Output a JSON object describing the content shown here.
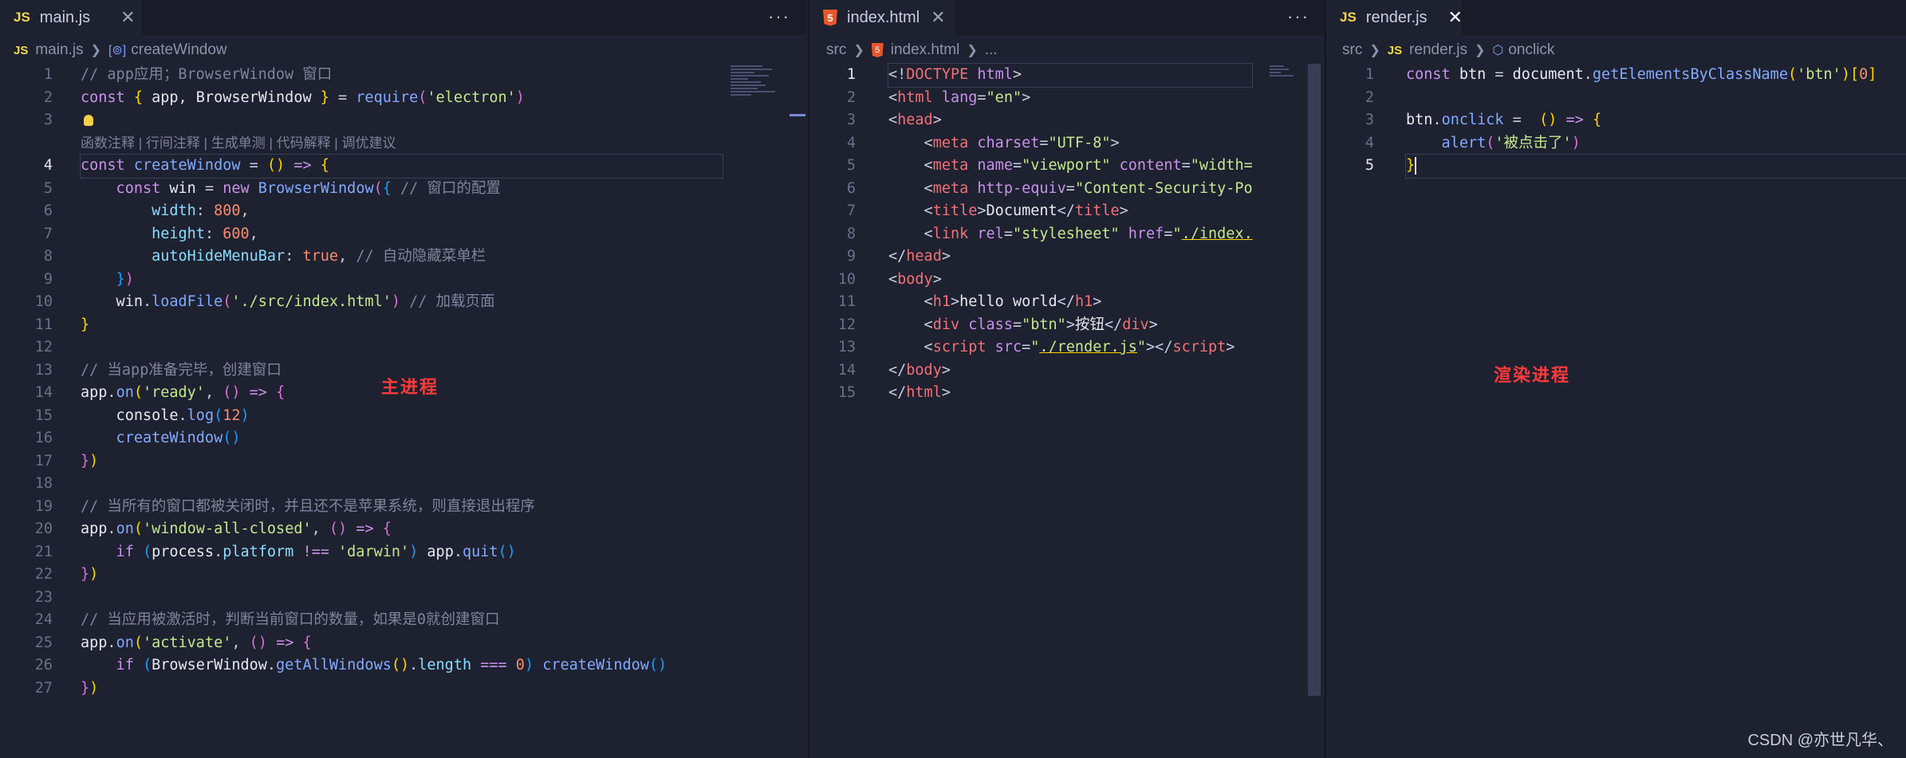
{
  "panes": [
    {
      "tab": {
        "icon": "JS",
        "label": "main.js",
        "close": "✕"
      },
      "breadcrumb": {
        "file_icon": "JS",
        "file": "main.js",
        "symbol": "createWindow"
      },
      "more": "···",
      "codelens": "函数注释 | 行间注释 | 生成单测 | 代码解释 | 调优建议"
    },
    {
      "tab": {
        "icon": "5",
        "label": "index.html",
        "close": "✕"
      },
      "breadcrumb": {
        "folder": "src",
        "file_icon": "5",
        "file": "index.html",
        "symbol": "..."
      },
      "more": "···"
    },
    {
      "tab": {
        "icon": "JS",
        "label": "render.js",
        "close": "✕"
      },
      "breadcrumb": {
        "folder": "src",
        "file_icon": "JS",
        "file": "render.js",
        "symbol": "onclick"
      }
    }
  ],
  "annotations": {
    "main_process": "主进程",
    "render_process": "渲染进程"
  },
  "watermark": "CSDN @亦世凡华、",
  "code": {
    "main": [
      [
        [
          "// app应用；BrowserWindow 窗口",
          "cm"
        ]
      ],
      [
        [
          "const ",
          "kw"
        ],
        [
          "{",
          "br1"
        ],
        [
          " app, ",
          "var"
        ],
        [
          "BrowserWindow",
          "var"
        ],
        [
          " ",
          "pl"
        ],
        [
          "}",
          "br1"
        ],
        [
          " = ",
          "pl"
        ],
        [
          "require",
          "fn"
        ],
        [
          "(",
          "br2"
        ],
        [
          "'electron'",
          "str"
        ],
        [
          ")",
          "br2"
        ]
      ],
      [],
      [
        [
          "const ",
          "kw"
        ],
        [
          "createWindow",
          "fn"
        ],
        [
          " = ",
          "pl"
        ],
        [
          "()",
          "br1"
        ],
        [
          " => ",
          "kw"
        ],
        [
          "{",
          "br1"
        ]
      ],
      [
        [
          "    const ",
          "kw"
        ],
        [
          "win",
          "var"
        ],
        [
          " = ",
          "pl"
        ],
        [
          "new ",
          "kw"
        ],
        [
          "BrowserWindow",
          "fn"
        ],
        [
          "(",
          "br2"
        ],
        [
          "{",
          "br3"
        ],
        [
          " // 窗口的配置",
          "cm"
        ]
      ],
      [
        [
          "        width",
          "prop"
        ],
        [
          ": ",
          "pl"
        ],
        [
          "800",
          "num"
        ],
        [
          ",",
          "pl"
        ]
      ],
      [
        [
          "        height",
          "prop"
        ],
        [
          ": ",
          "pl"
        ],
        [
          "600",
          "num"
        ],
        [
          ",",
          "pl"
        ]
      ],
      [
        [
          "        autoHideMenuBar",
          "prop"
        ],
        [
          ": ",
          "pl"
        ],
        [
          "true",
          "num"
        ],
        [
          ", ",
          "pl"
        ],
        [
          "// 自动隐藏菜单栏",
          "cm"
        ]
      ],
      [
        [
          "    }",
          "br3"
        ],
        [
          ")",
          "br2"
        ]
      ],
      [
        [
          "    win",
          "var"
        ],
        [
          ".",
          "pl"
        ],
        [
          "loadFile",
          "fn"
        ],
        [
          "(",
          "br2"
        ],
        [
          "'./src/index.html'",
          "str"
        ],
        [
          ")",
          "br2"
        ],
        [
          " // 加载页面",
          "cm"
        ]
      ],
      [
        [
          "}",
          "br1"
        ]
      ],
      [],
      [
        [
          "// 当app准备完毕，创建窗口",
          "cm"
        ]
      ],
      [
        [
          "app",
          "var"
        ],
        [
          ".",
          "pl"
        ],
        [
          "on",
          "fn"
        ],
        [
          "(",
          "br1"
        ],
        [
          "'ready'",
          "str"
        ],
        [
          ", ",
          "pl"
        ],
        [
          "()",
          "br2"
        ],
        [
          " => ",
          "kw"
        ],
        [
          "{",
          "br2"
        ]
      ],
      [
        [
          "    console",
          "var"
        ],
        [
          ".",
          "pl"
        ],
        [
          "log",
          "fn"
        ],
        [
          "(",
          "br3"
        ],
        [
          "12",
          "num"
        ],
        [
          ")",
          "br3"
        ]
      ],
      [
        [
          "    createWindow",
          "fn"
        ],
        [
          "()",
          "br3"
        ]
      ],
      [
        [
          "}",
          "br2"
        ],
        [
          ")",
          "br1"
        ]
      ],
      [],
      [
        [
          "// 当所有的窗口都被关闭时，并且还不是苹果系统，则直接退出程序",
          "cm"
        ]
      ],
      [
        [
          "app",
          "var"
        ],
        [
          ".",
          "pl"
        ],
        [
          "on",
          "fn"
        ],
        [
          "(",
          "br1"
        ],
        [
          "'window-all-closed'",
          "str"
        ],
        [
          ", ",
          "pl"
        ],
        [
          "()",
          "br2"
        ],
        [
          " => ",
          "kw"
        ],
        [
          "{",
          "br2"
        ]
      ],
      [
        [
          "    if ",
          "kw"
        ],
        [
          "(",
          "br3"
        ],
        [
          "process",
          "var"
        ],
        [
          ".",
          "pl"
        ],
        [
          "platform",
          "prop"
        ],
        [
          " !== ",
          "kw"
        ],
        [
          "'darwin'",
          "str"
        ],
        [
          ")",
          "br3"
        ],
        [
          " app",
          "var"
        ],
        [
          ".",
          "pl"
        ],
        [
          "quit",
          "fn"
        ],
        [
          "()",
          "br3"
        ]
      ],
      [
        [
          "}",
          "br2"
        ],
        [
          ")",
          "br1"
        ]
      ],
      [],
      [
        [
          "// 当应用被激活时，判断当前窗口的数量，如果是0就创建窗口",
          "cm"
        ]
      ],
      [
        [
          "app",
          "var"
        ],
        [
          ".",
          "pl"
        ],
        [
          "on",
          "fn"
        ],
        [
          "(",
          "br1"
        ],
        [
          "'activate'",
          "str"
        ],
        [
          ", ",
          "pl"
        ],
        [
          "()",
          "br2"
        ],
        [
          " => ",
          "kw"
        ],
        [
          "{",
          "br2"
        ]
      ],
      [
        [
          "    if ",
          "kw"
        ],
        [
          "(",
          "br3"
        ],
        [
          "BrowserWindow",
          "var"
        ],
        [
          ".",
          "pl"
        ],
        [
          "getAllWindows",
          "fn"
        ],
        [
          "()",
          "br1"
        ],
        [
          ".",
          "pl"
        ],
        [
          "length",
          "prop"
        ],
        [
          " === ",
          "kw"
        ],
        [
          "0",
          "num"
        ],
        [
          ")",
          "br3"
        ],
        [
          " createWindow",
          "fn"
        ],
        [
          "()",
          "br3"
        ]
      ],
      [
        [
          "}",
          "br2"
        ],
        [
          ")",
          "br1"
        ]
      ]
    ],
    "html": [
      [
        [
          "<!",
          "pl"
        ],
        [
          "DOCTYPE ",
          "tag"
        ],
        [
          "html",
          "attr"
        ],
        [
          ">",
          "pl"
        ]
      ],
      [
        [
          "<",
          "pl"
        ],
        [
          "html ",
          "tag"
        ],
        [
          "lang",
          "attr"
        ],
        [
          "=",
          "pl"
        ],
        [
          "\"en\"",
          "str"
        ],
        [
          ">",
          "pl"
        ]
      ],
      [
        [
          "<",
          "pl"
        ],
        [
          "head",
          "tag"
        ],
        [
          ">",
          "pl"
        ]
      ],
      [
        [
          "    <",
          "pl"
        ],
        [
          "meta ",
          "tag"
        ],
        [
          "charset",
          "attr"
        ],
        [
          "=",
          "pl"
        ],
        [
          "\"UTF-8\"",
          "str"
        ],
        [
          ">",
          "pl"
        ]
      ],
      [
        [
          "    <",
          "pl"
        ],
        [
          "meta ",
          "tag"
        ],
        [
          "name",
          "attr"
        ],
        [
          "=",
          "pl"
        ],
        [
          "\"viewport\"",
          "str"
        ],
        [
          " content",
          "attr"
        ],
        [
          "=",
          "pl"
        ],
        [
          "\"width=",
          "str"
        ]
      ],
      [
        [
          "    <",
          "pl"
        ],
        [
          "meta ",
          "tag"
        ],
        [
          "http-equiv",
          "attr"
        ],
        [
          "=",
          "pl"
        ],
        [
          "\"Content-Security-Po",
          "str"
        ]
      ],
      [
        [
          "    <",
          "pl"
        ],
        [
          "title",
          "tag"
        ],
        [
          ">",
          "pl"
        ],
        [
          "Document",
          "var"
        ],
        [
          "</",
          "pl"
        ],
        [
          "title",
          "tag"
        ],
        [
          ">",
          "pl"
        ]
      ],
      [
        [
          "    <",
          "pl"
        ],
        [
          "link ",
          "tag"
        ],
        [
          "rel",
          "attr"
        ],
        [
          "=",
          "pl"
        ],
        [
          "\"stylesheet\"",
          "str"
        ],
        [
          " href",
          "attr"
        ],
        [
          "=",
          "pl"
        ],
        [
          "\"",
          "str"
        ],
        [
          "./index.",
          "und"
        ]
      ],
      [
        [
          "</",
          "pl"
        ],
        [
          "head",
          "tag"
        ],
        [
          ">",
          "pl"
        ]
      ],
      [
        [
          "<",
          "pl"
        ],
        [
          "body",
          "tag"
        ],
        [
          ">",
          "pl"
        ]
      ],
      [
        [
          "    <",
          "pl"
        ],
        [
          "h1",
          "tag"
        ],
        [
          ">",
          "pl"
        ],
        [
          "hello world",
          "var"
        ],
        [
          "</",
          "pl"
        ],
        [
          "h1",
          "tag"
        ],
        [
          ">",
          "pl"
        ]
      ],
      [
        [
          "    <",
          "pl"
        ],
        [
          "div ",
          "tag"
        ],
        [
          "class",
          "attr"
        ],
        [
          "=",
          "pl"
        ],
        [
          "\"btn\"",
          "str"
        ],
        [
          ">",
          "pl"
        ],
        [
          "按钮",
          "var"
        ],
        [
          "</",
          "pl"
        ],
        [
          "div",
          "tag"
        ],
        [
          ">",
          "pl"
        ]
      ],
      [
        [
          "    <",
          "pl"
        ],
        [
          "script ",
          "tag"
        ],
        [
          "src",
          "attr"
        ],
        [
          "=",
          "pl"
        ],
        [
          "\"",
          "str"
        ],
        [
          "./render.js",
          "und"
        ],
        [
          "\"",
          "str"
        ],
        [
          "></",
          "pl"
        ],
        [
          "script",
          "tag"
        ],
        [
          ">",
          "pl"
        ]
      ],
      [
        [
          "</",
          "pl"
        ],
        [
          "body",
          "tag"
        ],
        [
          ">",
          "pl"
        ]
      ],
      [
        [
          "</",
          "pl"
        ],
        [
          "html",
          "tag"
        ],
        [
          ">",
          "pl"
        ]
      ]
    ],
    "render": [
      [
        [
          "const ",
          "kw"
        ],
        [
          "btn",
          "var"
        ],
        [
          " = ",
          "pl"
        ],
        [
          "document",
          "var"
        ],
        [
          ".",
          "pl"
        ],
        [
          "getElementsByClassName",
          "fn"
        ],
        [
          "(",
          "br1"
        ],
        [
          "'btn'",
          "str"
        ],
        [
          ")",
          "br1"
        ],
        [
          "[",
          "br1"
        ],
        [
          "0",
          "num"
        ],
        [
          "]",
          "br1"
        ]
      ],
      [],
      [
        [
          "btn",
          "var"
        ],
        [
          ".",
          "pl"
        ],
        [
          "onclick",
          "fn"
        ],
        [
          " = ",
          "pl"
        ],
        [
          " ",
          "pl"
        ],
        [
          "()",
          "br1"
        ],
        [
          " => ",
          "kw"
        ],
        [
          "{",
          "br1"
        ]
      ],
      [
        [
          "    alert",
          "fn"
        ],
        [
          "(",
          "br2"
        ],
        [
          "'被点击了'",
          "str"
        ],
        [
          ")",
          "br2"
        ]
      ],
      [
        [
          "}",
          "br1"
        ]
      ]
    ]
  }
}
